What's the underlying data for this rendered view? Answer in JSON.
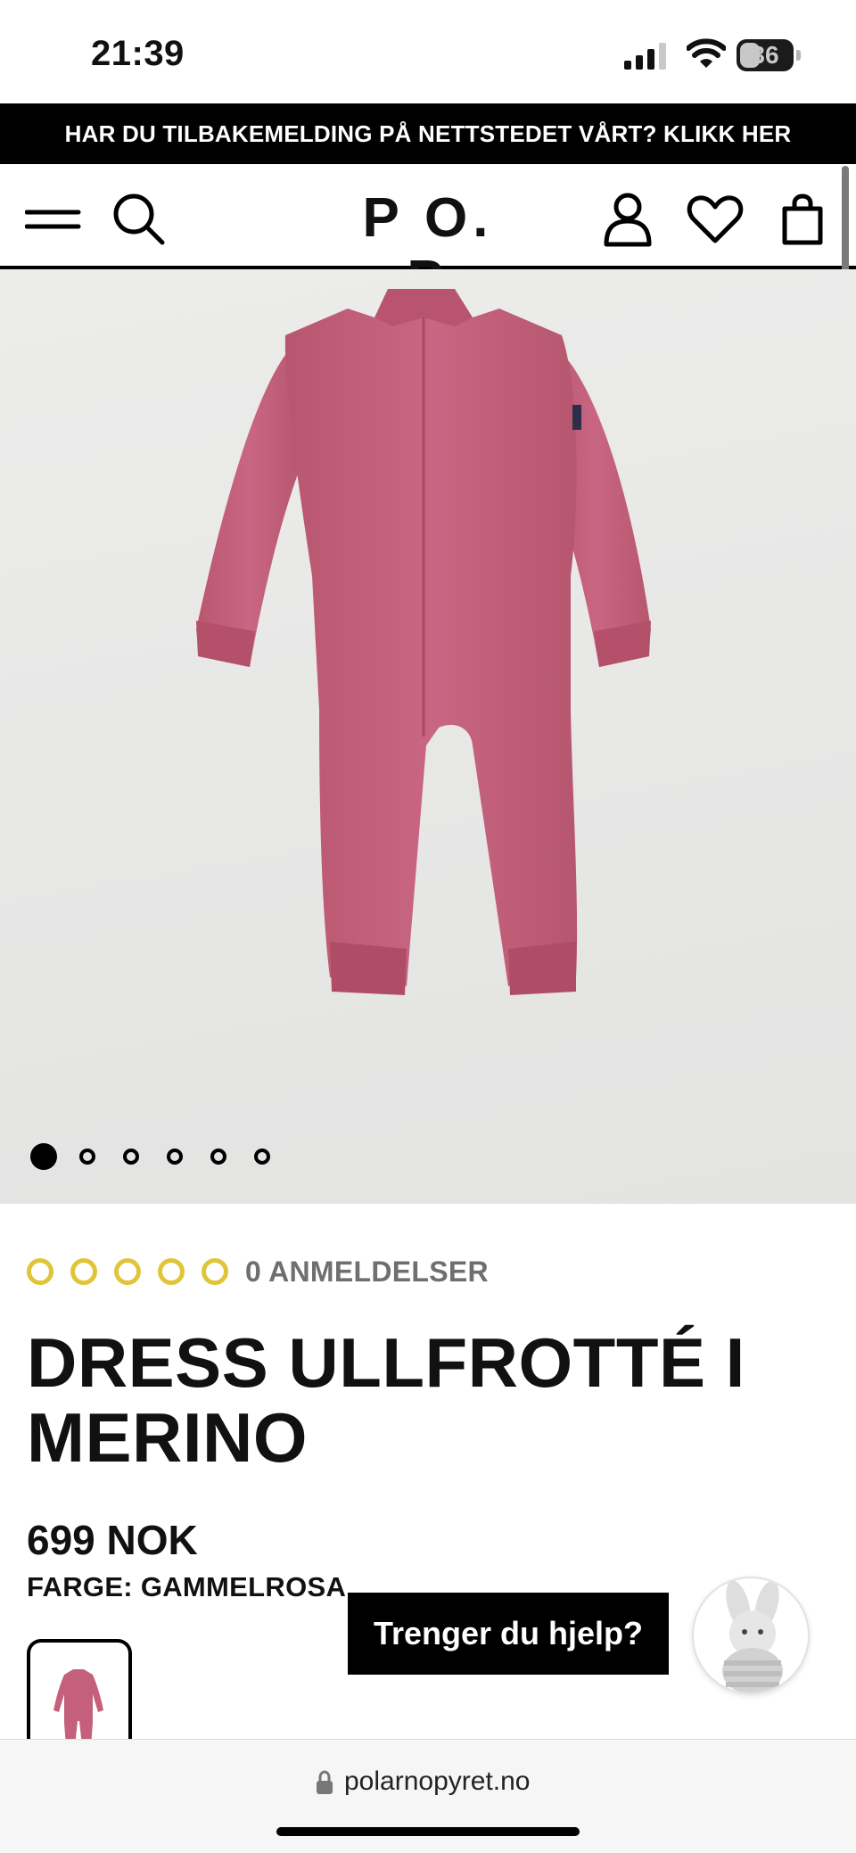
{
  "status_bar": {
    "time": "21:39",
    "battery": "36"
  },
  "banner": {
    "text": "HAR DU TILBAKEMELDING PÅ NETTSTEDET VÅRT? KLIKK HER"
  },
  "header": {
    "logo": "P O. P",
    "icons": [
      "menu-icon",
      "search-icon",
      "account-icon",
      "heart-icon",
      "bag-icon"
    ]
  },
  "gallery": {
    "image_count": 6,
    "active_index": 0
  },
  "rating": {
    "stars": 5,
    "filled": 0,
    "reviews_label": "0 ANMELDELSER",
    "star_color": "#e0c43a"
  },
  "product": {
    "title": "DRESS ULLFROTTÉ I MERINO",
    "price": "699 NOK",
    "color_label": "FARGE: GAMMELROSA",
    "garment_color": "#c45f7c"
  },
  "help": {
    "label": "Trenger du hjelp?"
  },
  "browser": {
    "url": "polarnopyret.no"
  }
}
